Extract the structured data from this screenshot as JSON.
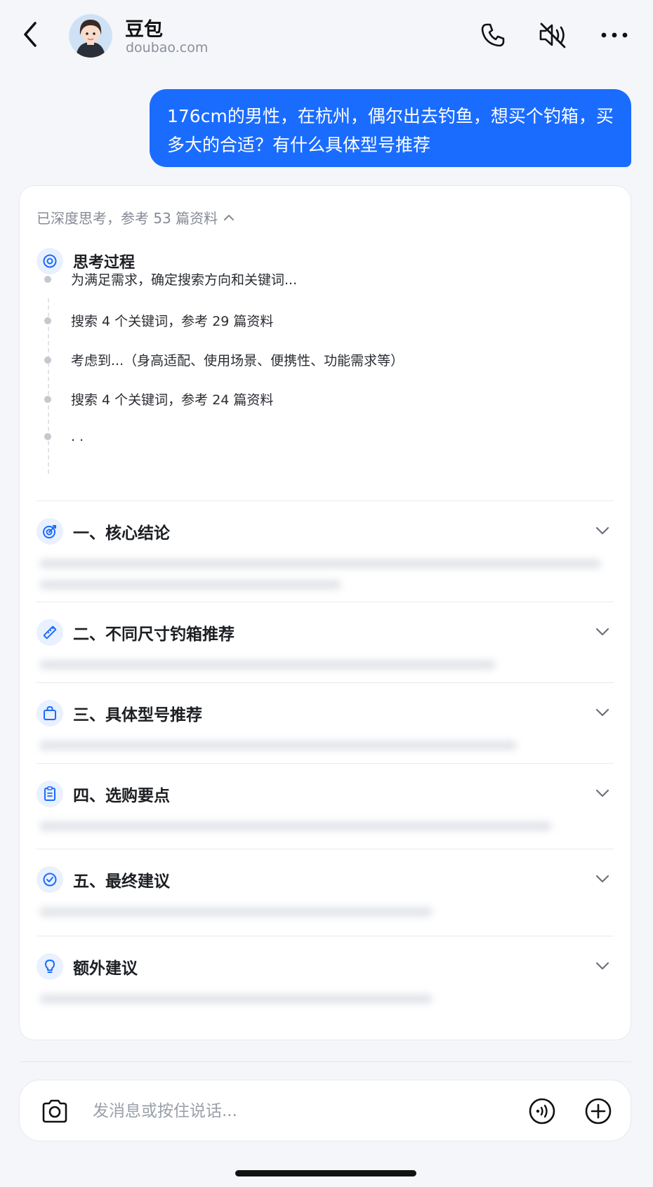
{
  "header": {
    "title": "豆包",
    "subtitle": "doubao.com",
    "icons": [
      "back-icon",
      "phone-icon",
      "speaker-mute-icon",
      "more-icon"
    ]
  },
  "user_message": "176cm的男性，在杭州，偶尔出去钓鱼，想买个钓箱，买多大的合适？有什么具体型号推荐",
  "response": {
    "deep_think_label": "已深度思考，参考 53 篇资料",
    "thinking_title": "思考过程",
    "steps": [
      "为满足需求，确定搜索方向和关键词...",
      "搜索 4 个关键词，参考 29 篇资料",
      "考虑到...（身高适配、使用场景、便携性、功能需求等）",
      "搜索 4 个关键词，参考 24 篇资料",
      ". ."
    ],
    "sections": [
      {
        "title": "一、核心结论",
        "icon": "target-icon"
      },
      {
        "title": "二、不同尺寸钓箱推荐",
        "icon": "ruler-icon"
      },
      {
        "title": "三、具体型号推荐",
        "icon": "shopping-bag-icon"
      },
      {
        "title": "四、选购要点",
        "icon": "clipboard-icon"
      },
      {
        "title": "五、最终建议",
        "icon": "check-circle-icon"
      },
      {
        "title": "额外建议",
        "icon": "lightbulb-icon"
      }
    ]
  },
  "input": {
    "placeholder": "发消息或按住说话..."
  },
  "colors": {
    "accent": "#1a6cff",
    "background": "#f4f6fa",
    "card": "#ffffff",
    "icon_bg": "#e9f0ff"
  }
}
